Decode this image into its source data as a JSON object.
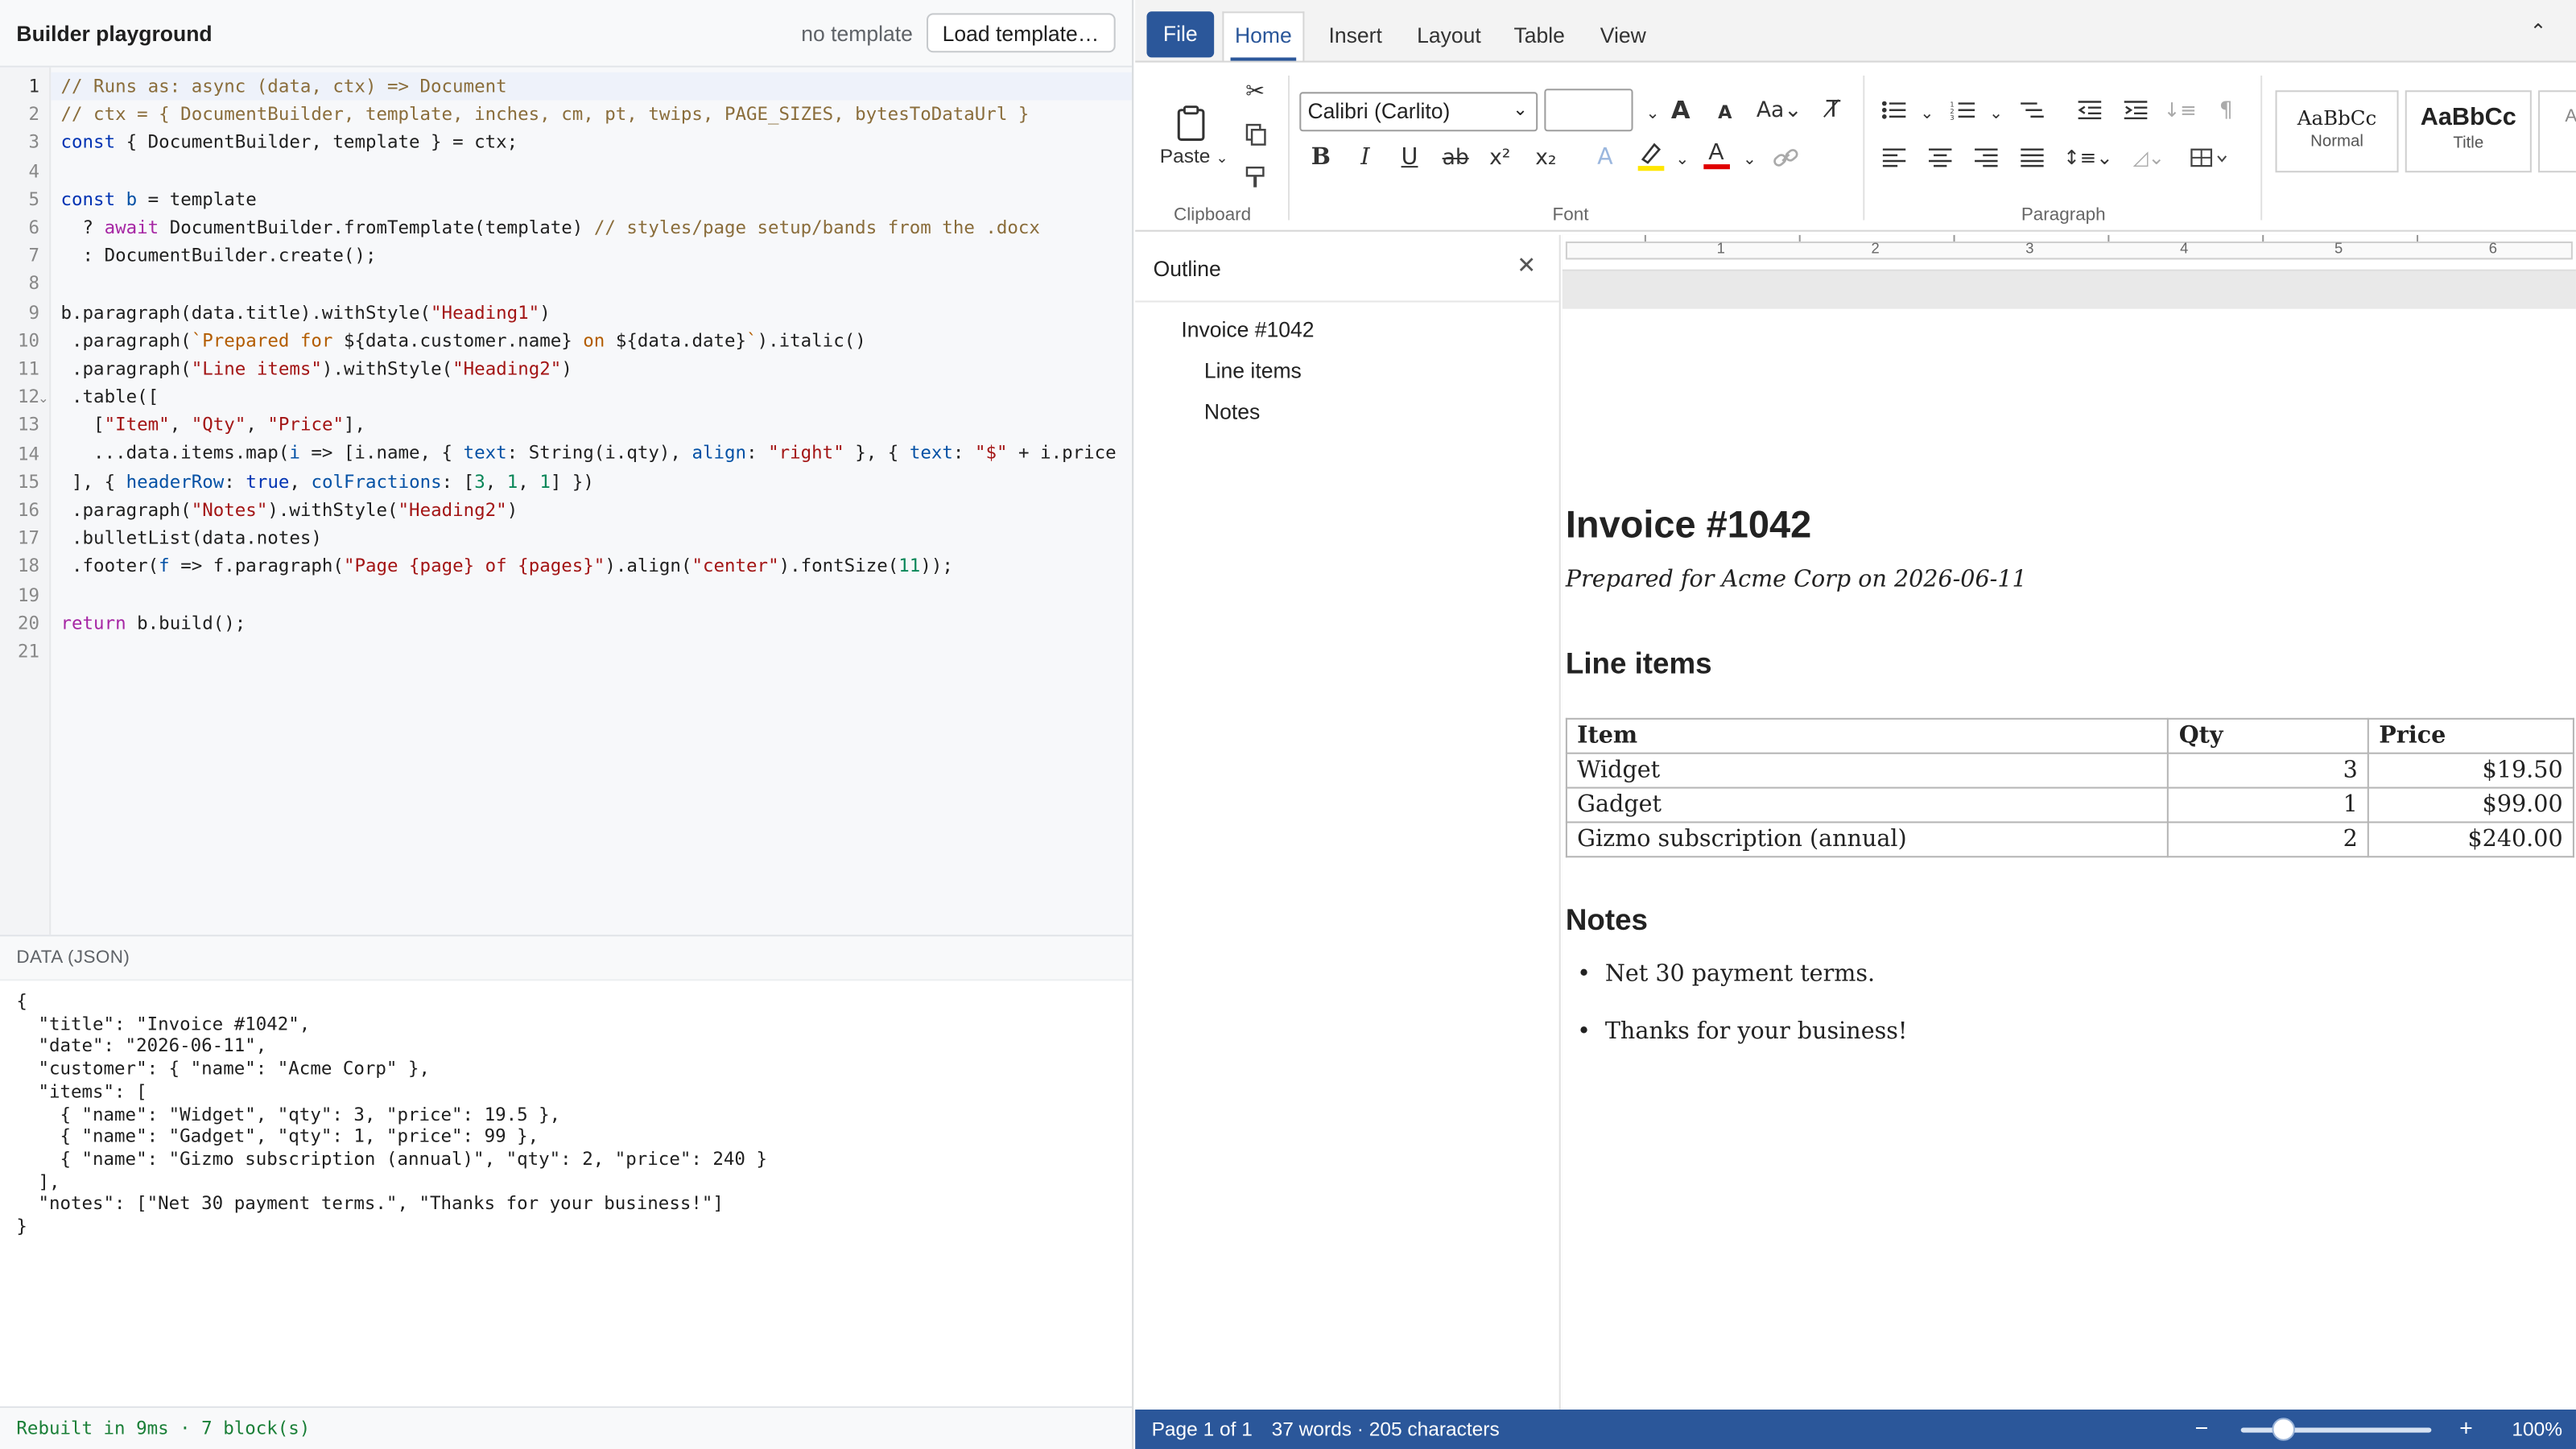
{
  "left": {
    "title": "Builder playground",
    "template_status": "no template",
    "load_button": "Load template…",
    "code_lines": [
      [
        [
          "// Runs as: async (data, ctx) => Document",
          "c-comment"
        ]
      ],
      [
        [
          "// ctx = { DocumentBuilder, template, inches, cm, pt, twips, PAGE_SIZES, bytesToDataUrl }",
          "c-comment"
        ]
      ],
      [
        [
          "const",
          "c-kw2"
        ],
        [
          " { DocumentBuilder, template } = ctx;",
          ""
        ]
      ],
      [],
      [
        [
          "const",
          "c-kw2"
        ],
        [
          " ",
          ""
        ],
        [
          "b",
          "c-prop"
        ],
        [
          " = template",
          ""
        ]
      ],
      [
        [
          "  ? ",
          ""
        ],
        [
          "await",
          "c-kw"
        ],
        [
          " DocumentBuilder.fromTemplate(template) ",
          ""
        ],
        [
          "// styles/page setup/bands from the .docx",
          "c-comment"
        ]
      ],
      [
        [
          "  : DocumentBuilder.create();",
          ""
        ]
      ],
      [],
      [
        [
          "b.paragraph(data.title).withStyle(",
          ""
        ],
        [
          "\"Heading1\"",
          "c-str"
        ],
        [
          ")",
          ""
        ]
      ],
      [
        [
          " .paragraph(",
          ""
        ],
        [
          "`Prepared for ",
          "c-tpl"
        ],
        [
          "${data.customer.name}",
          ""
        ],
        [
          " on ",
          "c-tpl"
        ],
        [
          "${data.date}",
          ""
        ],
        [
          "`",
          "c-tpl"
        ],
        [
          ").italic()",
          ""
        ]
      ],
      [
        [
          " .paragraph(",
          ""
        ],
        [
          "\"Line items\"",
          "c-str"
        ],
        [
          ").withStyle(",
          ""
        ],
        [
          "\"Heading2\"",
          "c-str"
        ],
        [
          ")",
          ""
        ]
      ],
      [
        [
          " .table([",
          ""
        ]
      ],
      [
        [
          "   [",
          ""
        ],
        [
          "\"Item\"",
          "c-str"
        ],
        [
          ", ",
          ""
        ],
        [
          "\"Qty\"",
          "c-str"
        ],
        [
          ", ",
          ""
        ],
        [
          "\"Price\"",
          "c-str"
        ],
        [
          "],",
          ""
        ]
      ],
      [
        [
          "   ...data.items.map(",
          ""
        ],
        [
          "i",
          "c-prop"
        ],
        [
          " => [i.name, { ",
          ""
        ],
        [
          "text",
          "c-prop"
        ],
        [
          ": String(i.qty), ",
          ""
        ],
        [
          "align",
          "c-prop"
        ],
        [
          ": ",
          ""
        ],
        [
          "\"right\"",
          "c-str"
        ],
        [
          " }, { ",
          ""
        ],
        [
          "text",
          "c-prop"
        ],
        [
          ": ",
          ""
        ],
        [
          "\"$\"",
          "c-str"
        ],
        [
          " + i.price",
          ""
        ]
      ],
      [
        [
          " ], { ",
          ""
        ],
        [
          "headerRow",
          "c-prop"
        ],
        [
          ": ",
          ""
        ],
        [
          "true",
          "c-kw2"
        ],
        [
          ", ",
          ""
        ],
        [
          "colFractions",
          "c-prop"
        ],
        [
          ": [",
          ""
        ],
        [
          "3",
          "c-num"
        ],
        [
          ", ",
          ""
        ],
        [
          "1",
          "c-num"
        ],
        [
          ", ",
          ""
        ],
        [
          "1",
          "c-num"
        ],
        [
          "] })",
          ""
        ]
      ],
      [
        [
          " .paragraph(",
          ""
        ],
        [
          "\"Notes\"",
          "c-str"
        ],
        [
          ").withStyle(",
          ""
        ],
        [
          "\"Heading2\"",
          "c-str"
        ],
        [
          ")",
          ""
        ]
      ],
      [
        [
          " .bulletList(data.notes)",
          ""
        ]
      ],
      [
        [
          " .footer(",
          ""
        ],
        [
          "f",
          "c-prop"
        ],
        [
          " => f.paragraph(",
          ""
        ],
        [
          "\"Page {page} of {pages}\"",
          "c-str"
        ],
        [
          ").align(",
          ""
        ],
        [
          "\"center\"",
          "c-str"
        ],
        [
          ").fontSize(",
          ""
        ],
        [
          "11",
          "c-num"
        ],
        [
          "));",
          ""
        ]
      ],
      [],
      [
        [
          "return",
          "c-kw"
        ],
        [
          " b.build();",
          ""
        ]
      ],
      []
    ],
    "data_label": "DATA (JSON)",
    "data_json": "{\n  \"title\": \"Invoice #1042\",\n  \"date\": \"2026-06-11\",\n  \"customer\": { \"name\": \"Acme Corp\" },\n  \"items\": [\n    { \"name\": \"Widget\", \"qty\": 3, \"price\": 19.5 },\n    { \"name\": \"Gadget\", \"qty\": 1, \"price\": 99 },\n    { \"name\": \"Gizmo subscription (annual)\", \"qty\": 2, \"price\": 240 }\n  ],\n  \"notes\": [\"Net 30 payment terms.\", \"Thanks for your business!\"]\n}",
    "status": "Rebuilt in 9ms · 7 block(s)"
  },
  "ribbon": {
    "tabs": [
      "File",
      "Home",
      "Insert",
      "Layout",
      "Table",
      "View"
    ],
    "paste_label": "Paste",
    "font_name": "Calibri (Carlito)",
    "groups": {
      "clipboard": "Clipboard",
      "font": "Font",
      "paragraph": "Paragraph"
    },
    "styles": [
      {
        "sample": "AaBbCc",
        "name": "Normal"
      },
      {
        "sample": "AaBbCc",
        "name": "Title"
      }
    ],
    "colors": {
      "highlight": "#ffe600",
      "font_color": "#e00000",
      "accent": "#2b579a"
    }
  },
  "outline": {
    "title": "Outline",
    "items": [
      "Invoice #1042",
      "Line items",
      "Notes"
    ]
  },
  "ruler": [
    "1",
    "2",
    "3",
    "4",
    "5",
    "6"
  ],
  "document": {
    "title": "Invoice #1042",
    "subtitle": "Prepared for Acme Corp on 2026-06-11",
    "line_items_heading": "Line items",
    "table_header": [
      "Item",
      "Qty",
      "Price"
    ],
    "rows": [
      [
        "Widget",
        "3",
        "$19.50"
      ],
      [
        "Gadget",
        "1",
        "$99.00"
      ],
      [
        "Gizmo subscription (annual)",
        "2",
        "$240.00"
      ]
    ],
    "notes_heading": "Notes",
    "notes": [
      "Net 30 payment terms.",
      "Thanks for your business!"
    ]
  },
  "statusbar": {
    "page": "Page 1 of 1",
    "counts": "37 words · 205 characters",
    "zoom": "100%"
  }
}
